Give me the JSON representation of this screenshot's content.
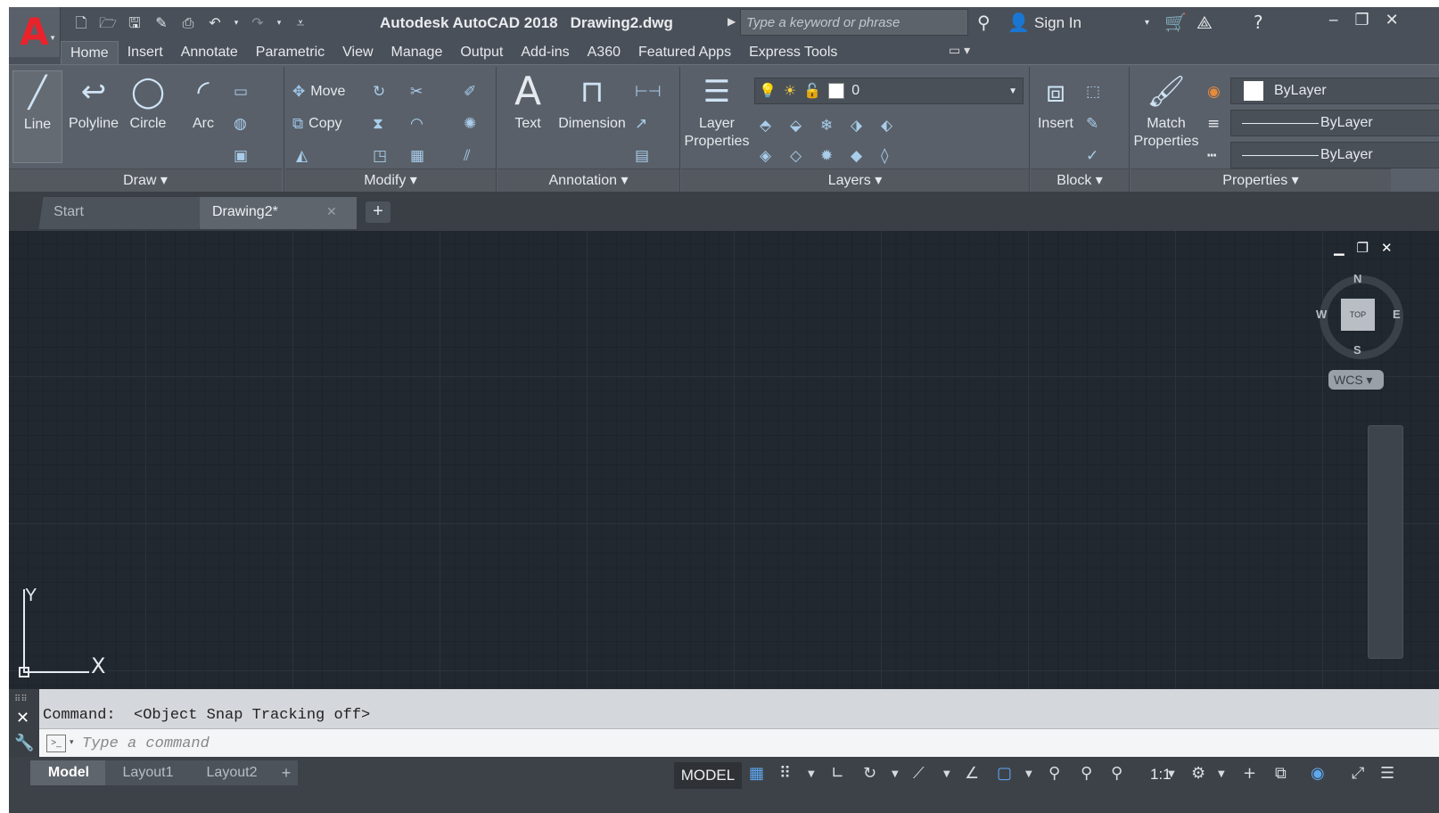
{
  "app": {
    "title": "Autodesk AutoCAD 2018",
    "document": "Drawing2.dwg",
    "logo_letter": "A"
  },
  "search": {
    "placeholder": "Type a keyword or phrase"
  },
  "account": {
    "signin_label": "Sign In"
  },
  "ribbon": {
    "tabs": [
      "Home",
      "Insert",
      "Annotate",
      "Parametric",
      "View",
      "Manage",
      "Output",
      "Add-ins",
      "A360",
      "Featured Apps",
      "Express Tools"
    ],
    "active_tab": "Home",
    "draw": {
      "line": "Line",
      "polyline": "Polyline",
      "circle": "Circle",
      "arc": "Arc",
      "panel": "Draw"
    },
    "modify": {
      "move": "Move",
      "copy": "Copy",
      "panel": "Modify"
    },
    "annotation": {
      "text": "Text",
      "dimension": "Dimension",
      "panel": "Annotation"
    },
    "layers": {
      "layer_properties": "Layer Properties",
      "current_layer": "0",
      "panel": "Layers"
    },
    "block": {
      "insert": "Insert",
      "panel": "Block"
    },
    "properties": {
      "match_properties": "Match Properties",
      "color": "ByLayer",
      "linetype": "ByLayer",
      "lineweight": "ByLayer",
      "panel": "Properties"
    }
  },
  "doc_tabs": {
    "start": "Start",
    "drawing": "Drawing2*"
  },
  "viewcube": {
    "top": "TOP",
    "n": "N",
    "s": "S",
    "e": "E",
    "w": "W",
    "wcs": "WCS"
  },
  "ucs": {
    "x": "X",
    "y": "Y"
  },
  "command": {
    "history": "Command:  <Object Snap Tracking off>",
    "placeholder": "Type a command"
  },
  "layouts": {
    "model": "Model",
    "layout1": "Layout1",
    "layout2": "Layout2"
  },
  "status": {
    "model": "MODEL",
    "scale": "1:1"
  },
  "colors": {
    "accent_red": "#e8232b",
    "canvas": "#212830",
    "ui_dark": "#4a5059"
  }
}
